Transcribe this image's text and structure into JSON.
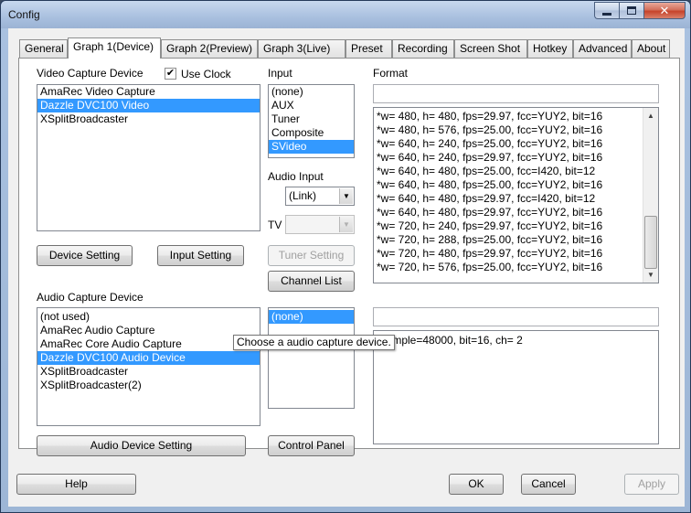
{
  "window": {
    "title": "Config"
  },
  "tabs": [
    "General",
    "Graph 1(Device)",
    "Graph 2(Preview)",
    "Graph 3(Live)",
    "Preset",
    "Recording",
    "Screen Shot",
    "Hotkey",
    "Advanced",
    "About"
  ],
  "video": {
    "label": "Video Capture Device",
    "use_clock_label": "Use Clock",
    "use_clock_checked": true,
    "devices": [
      "AmaRec Video Capture",
      "Dazzle DVC100 Video",
      "XSplitBroadcaster"
    ],
    "selected_index": 1,
    "device_setting_label": "Device Setting",
    "input_setting_label": "Input Setting"
  },
  "input": {
    "label": "Input",
    "items": [
      "(none)",
      "AUX",
      "Tuner",
      "Composite",
      "SVideo"
    ],
    "selected_index": 4,
    "audio_input_label": "Audio Input",
    "audio_input_value": "(Link)",
    "tv_label": "TV",
    "tuner_setting_label": "Tuner Setting",
    "channel_list_label": "Channel List"
  },
  "format": {
    "label": "Format",
    "field_value": "",
    "items": [
      "*w= 480, h= 480, fps=29.97,  fcc=YUY2, bit=16",
      "*w= 480, h= 576, fps=25.00,  fcc=YUY2, bit=16",
      "*w= 640, h= 240, fps=25.00,  fcc=YUY2, bit=16",
      "*w= 640, h= 240, fps=29.97,  fcc=YUY2, bit=16",
      "*w= 640, h= 480, fps=25.00,  fcc=I420, bit=12",
      "*w= 640, h= 480, fps=25.00,  fcc=YUY2, bit=16",
      "*w= 640, h= 480, fps=29.97,  fcc=I420, bit=12",
      "*w= 640, h= 480, fps=29.97,  fcc=YUY2, bit=16",
      "*w= 720, h= 240, fps=29.97,  fcc=YUY2, bit=16",
      "*w= 720, h= 288, fps=25.00,  fcc=YUY2, bit=16",
      "*w= 720, h= 480, fps=29.97,  fcc=YUY2, bit=16",
      "*w= 720, h= 576, fps=25.00,  fcc=YUY2, bit=16"
    ]
  },
  "audio": {
    "label": "Audio Capture Device",
    "devices": [
      "(not used)",
      "AmaRec Audio Capture",
      "AmaRec Core Audio Capture",
      "Dazzle DVC100 Audio Device",
      "XSplitBroadcaster",
      "XSplitBroadcaster(2)"
    ],
    "selected_index": 3,
    "tooltip": "Choose a audio capture device.",
    "device_setting_label": "Audio Device Setting",
    "input_items": [
      "(none)"
    ],
    "control_panel_label": "Control Panel",
    "format_field_value": "",
    "format_items": [
      "*sample=48000, bit=16, ch= 2"
    ]
  },
  "footer": {
    "help_label": "Help",
    "ok_label": "OK",
    "cancel_label": "Cancel",
    "apply_label": "Apply"
  }
}
